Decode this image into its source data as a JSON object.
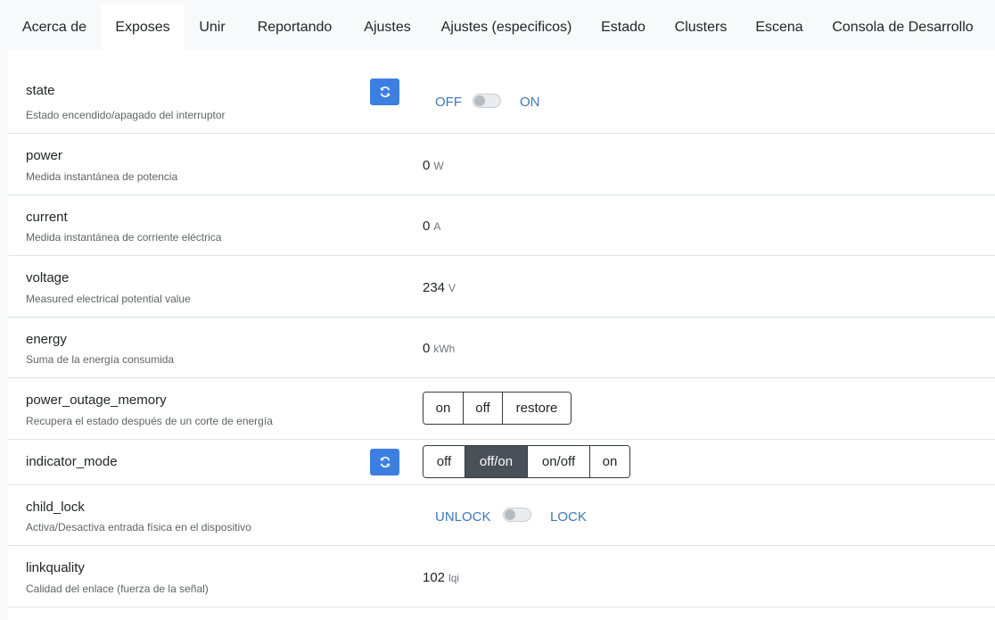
{
  "tabs": [
    "Acerca de",
    "Exposes",
    "Unir",
    "Reportando",
    "Ajustes",
    "Ajustes (especificos)",
    "Estado",
    "Clusters",
    "Escena",
    "Consola de Desarrollo"
  ],
  "active_tab": "Exposes",
  "exposes": {
    "state": {
      "name": "state",
      "description": "Estado encendido/apagado del interruptor",
      "off_label": "OFF",
      "on_label": "ON"
    },
    "power": {
      "name": "power",
      "description": "Medida instantánea de potencia",
      "value": "0",
      "unit": "W"
    },
    "current": {
      "name": "current",
      "description": "Medida instantánea de corriente eléctrica",
      "value": "0",
      "unit": "A"
    },
    "voltage": {
      "name": "voltage",
      "description": "Measured electrical potential value",
      "value": "234",
      "unit": "V"
    },
    "energy": {
      "name": "energy",
      "description": "Suma de la energía consumida",
      "value": "0",
      "unit": "kWh"
    },
    "power_outage_memory": {
      "name": "power_outage_memory",
      "description": "Recupera el estado después de un corte de energía",
      "options": [
        "on",
        "off",
        "restore"
      ]
    },
    "indicator_mode": {
      "name": "indicator_mode",
      "options": [
        "off",
        "off/on",
        "on/off",
        "on"
      ],
      "selected": "off/on"
    },
    "child_lock": {
      "name": "child_lock",
      "description": "Activa/Desactiva entrada física en el dispositivo",
      "off_label": "UNLOCK",
      "on_label": "LOCK"
    },
    "linkquality": {
      "name": "linkquality",
      "description": "Calidad del enlace (fuerza de la señal)",
      "value": "102",
      "unit": "lqi"
    }
  },
  "colors": {
    "accent_blue": "#3c7fe0",
    "toggle_label": "#3a78b8",
    "selected_button": "#495057"
  },
  "icons": {
    "refresh": "refresh-icon"
  }
}
